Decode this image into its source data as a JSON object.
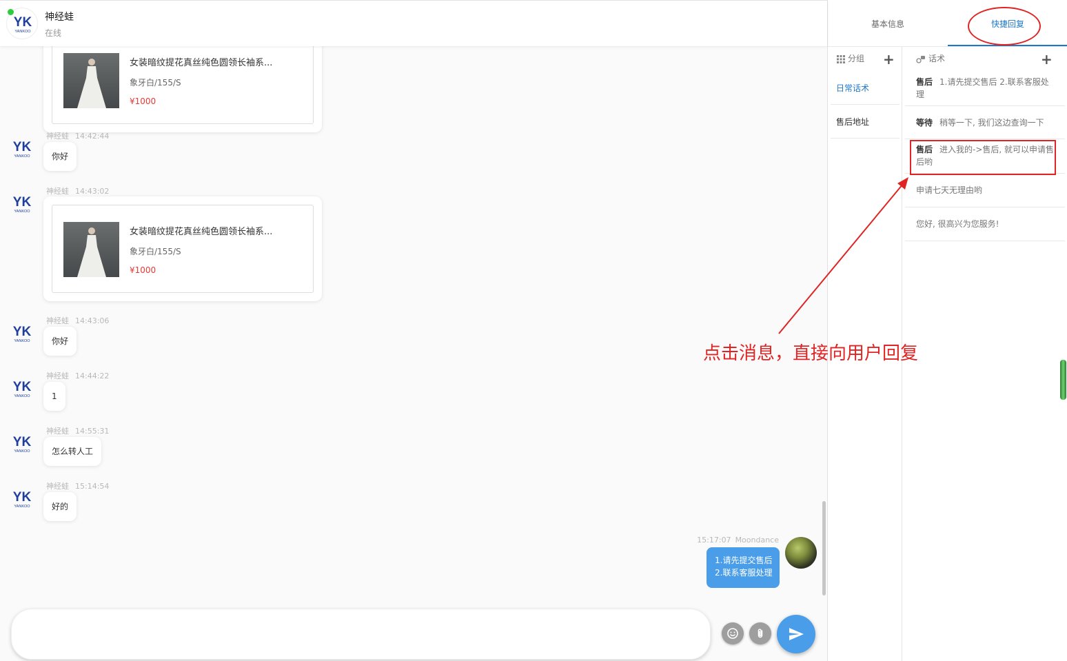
{
  "header": {
    "contact_name": "神经蛙",
    "contact_status": "在线"
  },
  "messages": [
    {
      "type": "product",
      "title": "女装暗纹提花真丝纯色圆领长袖系...",
      "spec": "象牙白/155/S",
      "price": "¥1000"
    },
    {
      "type": "text",
      "sender": "神经蛙",
      "time": "14:42:44",
      "text": "你好"
    },
    {
      "type": "product",
      "sender": "神经蛙",
      "time": "14:43:02",
      "title": "女装暗纹提花真丝纯色圆领长袖系...",
      "spec": "象牙白/155/S",
      "price": "¥1000"
    },
    {
      "type": "text",
      "sender": "神经蛙",
      "time": "14:43:06",
      "text": "你好"
    },
    {
      "type": "text",
      "sender": "神经蛙",
      "time": "14:44:22",
      "text": "1"
    },
    {
      "type": "text",
      "sender": "神经蛙",
      "time": "14:55:31",
      "text": "怎么转人工"
    },
    {
      "type": "text",
      "sender": "神经蛙",
      "time": "15:14:54",
      "text": "好的"
    }
  ],
  "self_message": {
    "time": "15:17:07",
    "sender": "Moondance",
    "line1": "1.请先提交售后",
    "line2": "2.联系客服处理"
  },
  "input": {
    "placeholder": "",
    "emoji_icon": "emoji-icon",
    "attach_icon": "paperclip-icon",
    "send_icon": "send-icon"
  },
  "right_panel": {
    "tabs": [
      {
        "label": "基本信息",
        "active": false
      },
      {
        "label": "快捷回复",
        "active": true
      }
    ],
    "groups_header": "分组",
    "phrases_header": "话术",
    "groups": [
      {
        "label": "日常话术",
        "active": true
      },
      {
        "label": "售后地址",
        "active": false
      }
    ],
    "phrases": [
      {
        "tag": "售后",
        "text": "1.请先提交售后 2.联系客服处理"
      },
      {
        "tag": "等待",
        "text": "稍等一下, 我们这边查询一下"
      },
      {
        "tag": "售后",
        "text": "进入我的->售后, 就可以申请售后哟"
      },
      {
        "tag": "",
        "text": "申请七天无理由哟"
      },
      {
        "tag": "",
        "text": "您好, 很高兴为您服务!"
      }
    ]
  },
  "annotation": {
    "text": "点击消息，直接向用户回复"
  },
  "colors": {
    "accent": "#4a9de8",
    "tab_active": "#1e78c8",
    "annotation": "#e02424",
    "price": "#e53935"
  }
}
